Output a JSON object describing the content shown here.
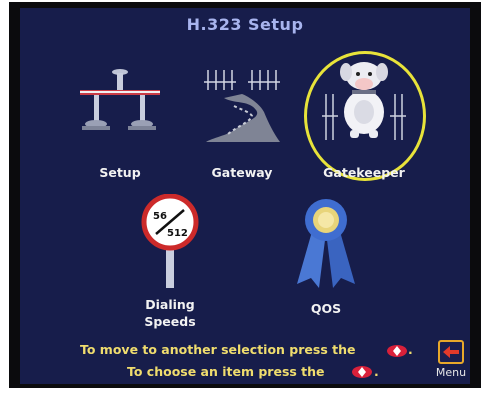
{
  "screen": {
    "title": "H.323 Setup"
  },
  "tiles": [
    {
      "label": "Setup",
      "icon": "network-topology-icon"
    },
    {
      "label": "Gateway",
      "icon": "gateway-icon"
    },
    {
      "label": "Gatekeeper",
      "icon": "gatekeeper-bulldog-icon"
    },
    {
      "label_line1": "Dialing",
      "label_line2": "Speeds",
      "icon": "speed-sign-icon",
      "sign_top": "56",
      "sign_bottom": "512"
    },
    {
      "label": "QOS",
      "icon": "ribbon-award-icon"
    }
  ],
  "selected": "Gatekeeper",
  "hints": {
    "move": "To move to another selection press the",
    "choose": "To choose an item press the"
  },
  "menu": {
    "label": "Menu"
  },
  "colors": {
    "panel": "#171d4b",
    "title": "#a8b4ee",
    "hint": "#f0dd6e",
    "selection": "#e8e33a",
    "key": "#d9203a"
  }
}
